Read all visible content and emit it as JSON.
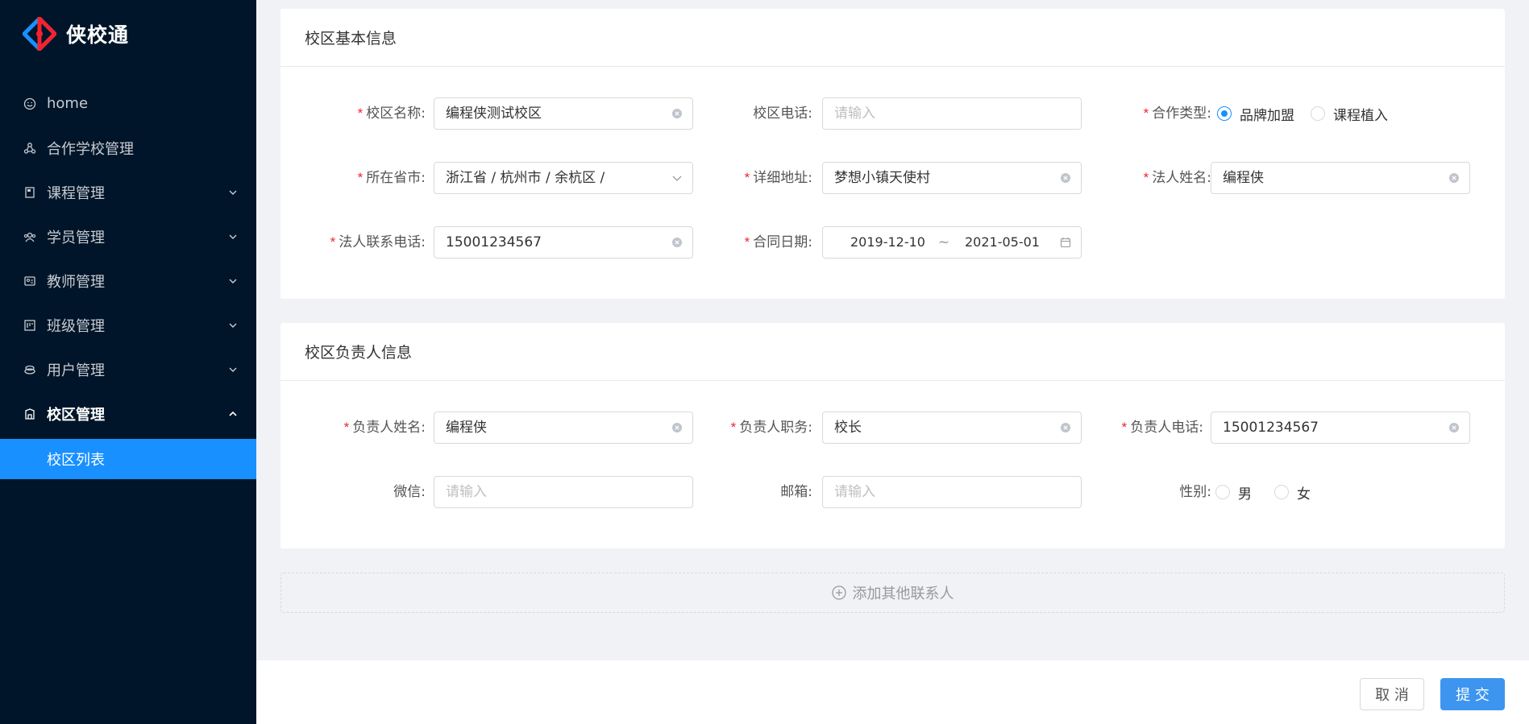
{
  "app": {
    "name": "侠校通"
  },
  "sidebar": {
    "items": [
      {
        "label": "home",
        "icon": "smile-icon"
      },
      {
        "label": "合作学校管理",
        "icon": "cluster-icon"
      },
      {
        "label": "课程管理",
        "icon": "book-icon",
        "expandable": true
      },
      {
        "label": "学员管理",
        "icon": "team-icon",
        "expandable": true
      },
      {
        "label": "教师管理",
        "icon": "idcard-icon",
        "expandable": true
      },
      {
        "label": "班级管理",
        "icon": "project-icon",
        "expandable": true
      },
      {
        "label": "用户管理",
        "icon": "user-group-icon",
        "expandable": true
      },
      {
        "label": "校区管理",
        "icon": "bank-icon",
        "expandable": true,
        "expanded": true
      }
    ],
    "submenu": {
      "label": "校区列表"
    }
  },
  "basic_info": {
    "title": "校区基本信息",
    "campus_name": {
      "label": "校区名称:",
      "value": "编程侠测试校区"
    },
    "campus_phone": {
      "label": "校区电话:",
      "placeholder": "请输入"
    },
    "coop_type": {
      "label": "合作类型:",
      "options": [
        "品牌加盟",
        "课程植入"
      ],
      "selected": "品牌加盟"
    },
    "province": {
      "label": "所在省市:",
      "value": "浙江省 / 杭州市 / 余杭区 /"
    },
    "address": {
      "label": "详细地址:",
      "value": "梦想小镇天使村"
    },
    "legal_name": {
      "label": "法人姓名:",
      "value": "编程侠"
    },
    "legal_phone": {
      "label": "法人联系电话:",
      "value": "15001234567"
    },
    "contract_date": {
      "label": "合同日期:",
      "start": "2019-12-10",
      "separator": "~",
      "end": "2021-05-01"
    }
  },
  "leader_info": {
    "title": "校区负责人信息",
    "leader_name": {
      "label": "负责人姓名:",
      "value": "编程侠"
    },
    "leader_title": {
      "label": "负责人职务:",
      "value": "校长"
    },
    "leader_phone": {
      "label": "负责人电话:",
      "value": "15001234567"
    },
    "wechat": {
      "label": "微信:",
      "placeholder": "请输入"
    },
    "email": {
      "label": "邮箱:",
      "placeholder": "请输入"
    },
    "gender": {
      "label": "性别:",
      "options": [
        "男",
        "女"
      ]
    }
  },
  "add_contact": {
    "label": "添加其他联系人"
  },
  "footer": {
    "cancel": "取 消",
    "submit": "提 交"
  },
  "colors": {
    "sidebar_bg": "#001529",
    "primary": "#1890ff",
    "required": "#f5222d"
  }
}
